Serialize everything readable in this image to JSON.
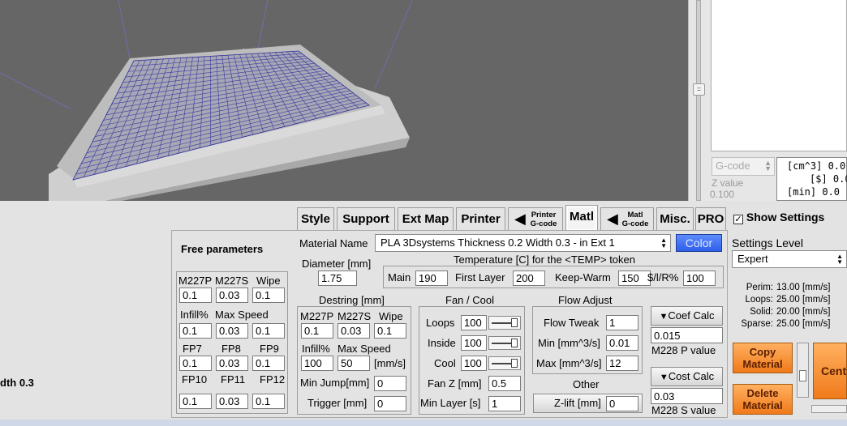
{
  "viewport": {
    "left_label": "dth 0.3"
  },
  "preview": {
    "gcode_select": "G-code",
    "z_label": "Z value",
    "z_value": "0.100",
    "info_lines": [
      "[cm^3] 0.0",
      "[$] 0.0",
      "[min] 0.0"
    ]
  },
  "tabs": [
    {
      "id": "style",
      "label": "Style"
    },
    {
      "id": "support",
      "label": "Support"
    },
    {
      "id": "extmap",
      "label": "Ext Map"
    },
    {
      "id": "printer",
      "label": "Printer"
    },
    {
      "id": "printer-gcode",
      "line1": "Printer",
      "line2": "G-code"
    },
    {
      "id": "matl",
      "label": "Matl"
    },
    {
      "id": "matl-gcode",
      "line1": "Matl",
      "line2": "G-code"
    },
    {
      "id": "misc",
      "label": "Misc."
    },
    {
      "id": "pro",
      "label": "PRO"
    }
  ],
  "show_settings": {
    "label": "Show Settings",
    "checked": true
  },
  "settings_level": {
    "label": "Settings Level",
    "value": "Expert"
  },
  "speeds": [
    {
      "label": "Perim:",
      "value": "13.00 [mm/s]"
    },
    {
      "label": "Loops:",
      "value": "25.00 [mm/s]"
    },
    {
      "label": "Solid:",
      "value": "20.00 [mm/s]"
    },
    {
      "label": "Sparse:",
      "value": "25.00 [mm/s]"
    }
  ],
  "buttons": {
    "copy_material": "Copy Material",
    "delete_material": "Delete Material",
    "center": "Cent"
  },
  "free_params": {
    "title": "Free parameters",
    "headers1": [
      "M227P",
      "M227S",
      "Wipe"
    ],
    "values1": [
      "0.1",
      "0.03",
      "0.1"
    ],
    "headers2": [
      "Infill%",
      "Max Speed"
    ],
    "values2": [
      "0.1",
      "0.03",
      "0.1"
    ],
    "headers3": [
      "FP7",
      "FP8",
      "FP9"
    ],
    "values3": [
      "0.1",
      "0.03",
      "0.1"
    ],
    "headers4": [
      "FP10",
      "FP11",
      "FP12"
    ],
    "values4": [
      "0.1",
      "0.03",
      "0.1"
    ]
  },
  "material": {
    "name_label": "Material Name",
    "name_value": "PLA 3Dsystems Thickness 0.2 Width 0.3 - in Ext 1",
    "color_label": "Color",
    "diameter_label": "Diameter [mm]",
    "diameter_value": "1.75",
    "temperature_title": "Temperature [C] for the <TEMP> token",
    "temp_main_label": "Main",
    "temp_main": "190",
    "temp_first_label": "First Layer",
    "temp_first": "200",
    "temp_keep_label": "Keep-Warm",
    "temp_keep": "150",
    "temp_sir_label": "$/l/R%",
    "temp_sir": "100"
  },
  "destring": {
    "title": "Destring [mm]",
    "headers1": [
      "M227P",
      "M227S",
      "Wipe"
    ],
    "values1": [
      "0.1",
      "0.03",
      "0.1"
    ],
    "headers2": [
      "Infill%",
      "Max Speed"
    ],
    "values2": [
      "100",
      "50"
    ],
    "unit": "[mm/s]",
    "min_jump_label": "Min Jump[mm]",
    "min_jump": "0",
    "trigger_label": "Trigger [mm]",
    "trigger": "0"
  },
  "fan": {
    "title": "Fan / Cool",
    "loops_label": "Loops",
    "loops": "100",
    "inside_label": "Inside",
    "inside": "100",
    "cool_label": "Cool",
    "cool": "100",
    "fanz_label": "Fan Z [mm]",
    "fanz": "0.5",
    "minlayer_label": "Min Layer [s]",
    "minlayer": "1"
  },
  "flow": {
    "title": "Flow Adjust",
    "tweak_label": "Flow Tweak",
    "tweak": "1",
    "min_label": "Min [mm^3/s]",
    "min": "0.01",
    "max_label": "Max [mm^3/s]",
    "max": "12"
  },
  "other": {
    "title": "Other",
    "zlift_label": "Z-lift [mm]",
    "zlift": "0"
  },
  "calc": {
    "coef_label": "Coef Calc",
    "coef_value": "0.015",
    "p_label": "M228 P value",
    "cost_label": "Cost Calc",
    "cost_value": "0.03",
    "s_label": "M228 S value"
  },
  "colors": {
    "accent_blue": "#2d5fe8",
    "orange": "#f07a1a",
    "grid_blue": "#2a2a9a"
  }
}
